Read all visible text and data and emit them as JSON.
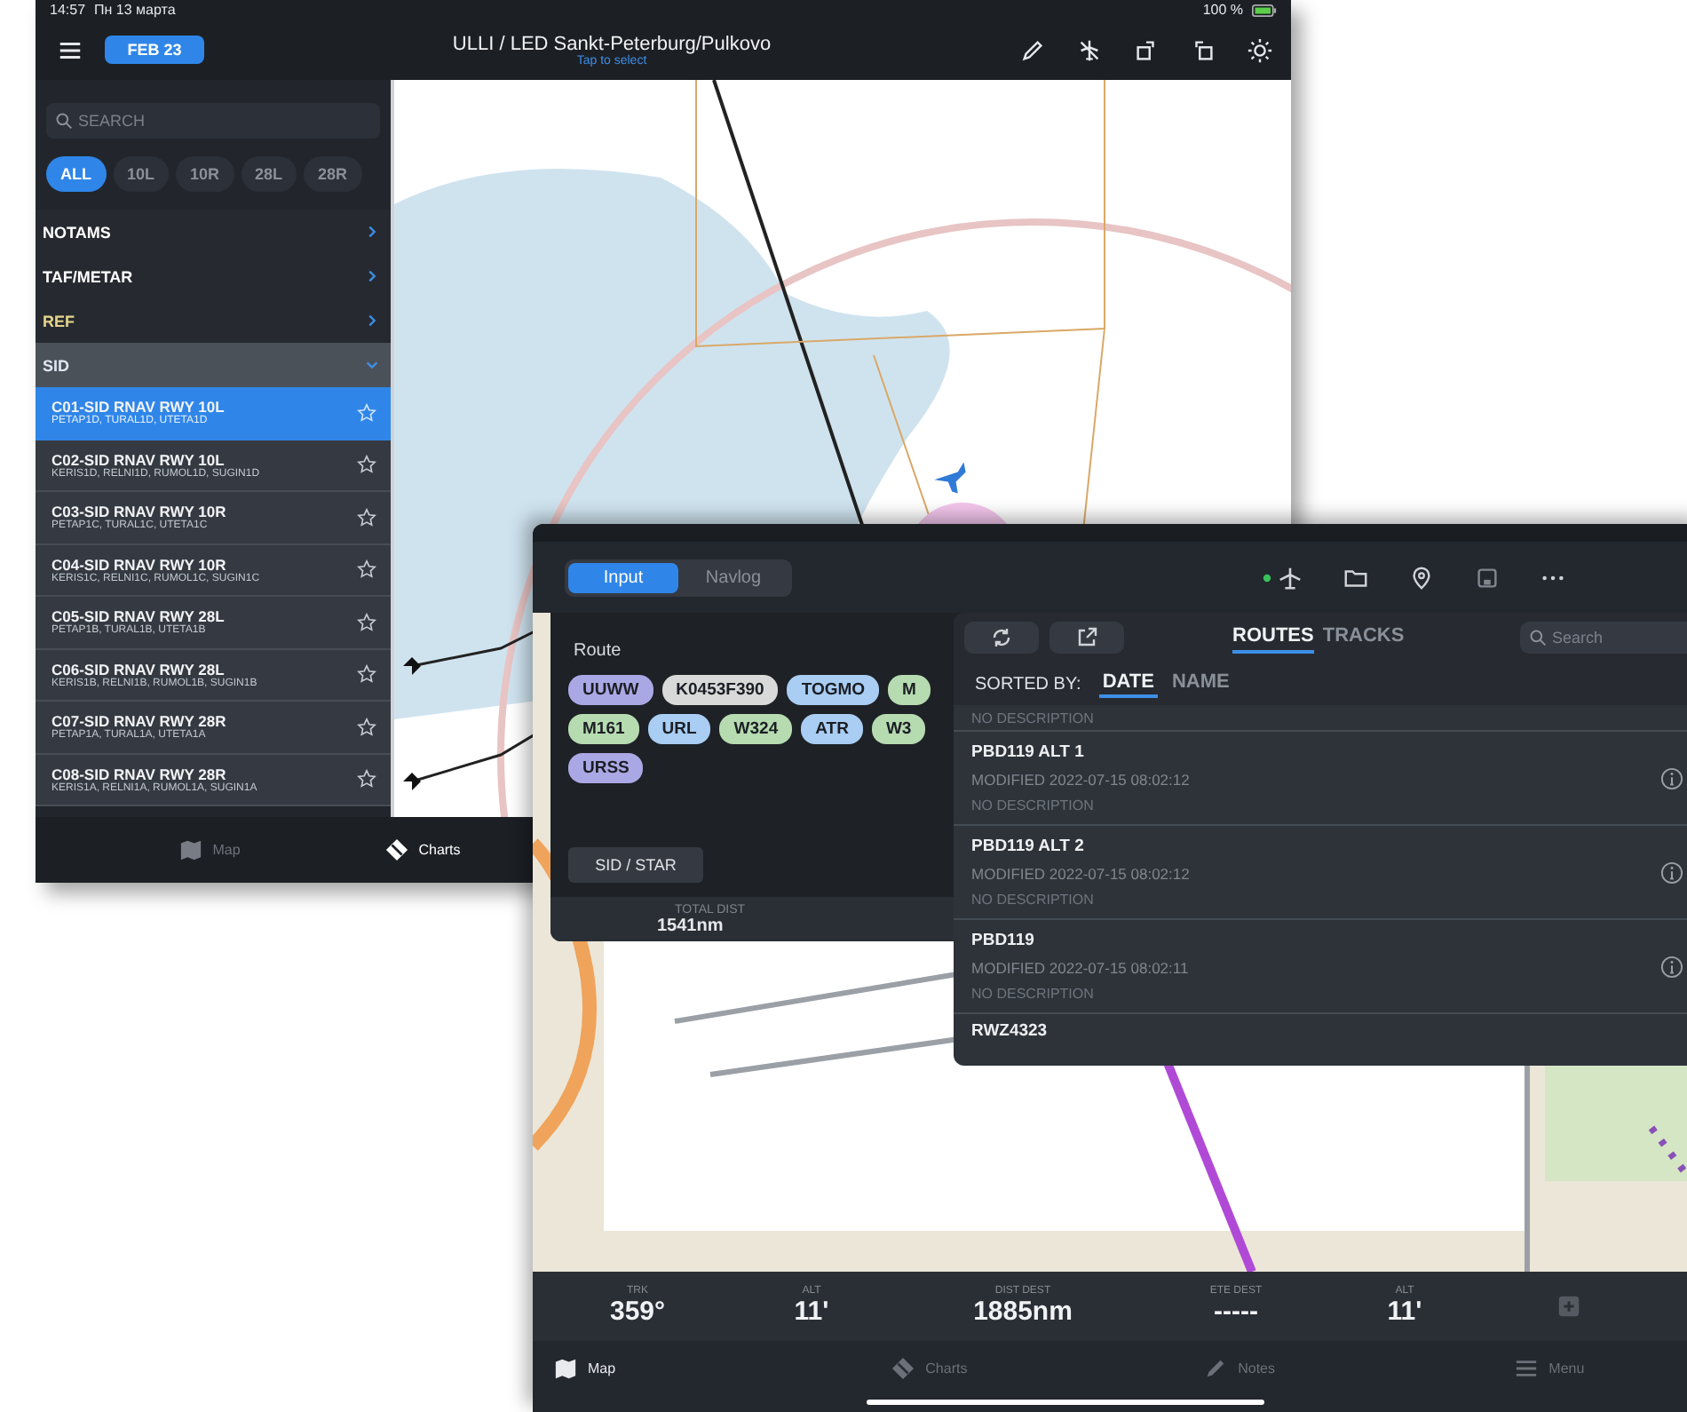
{
  "screen_a": {
    "status_bar": {
      "time": "14:57",
      "date": "Пн 13 марта",
      "battery": "100 %"
    },
    "header": {
      "date_button": "FEB 23",
      "title": "ULLI / LED Sankt-Peterburg/Pulkovo",
      "subtitle": "Tap to select"
    },
    "sidebar": {
      "search": {
        "placeholder": "SEARCH"
      },
      "filters": [
        {
          "label": "ALL",
          "selected": true
        },
        {
          "label": "10L",
          "selected": false
        },
        {
          "label": "10R",
          "selected": false
        },
        {
          "label": "28L",
          "selected": false
        },
        {
          "label": "28R",
          "selected": false
        }
      ],
      "sections": [
        {
          "label": "NOTAMS",
          "expanded": false,
          "color": "#ffffff"
        },
        {
          "label": "TAF/METAR",
          "expanded": false,
          "color": "#ffffff"
        },
        {
          "label": "REF",
          "expanded": false,
          "color": "#e6d48c"
        },
        {
          "label": "SID",
          "expanded": true,
          "color": "#dfe6f0"
        }
      ],
      "items": [
        {
          "title": "C01-SID RNAV RWY 10L",
          "subtitle": "PETAP1D, TURAL1D, UTETA1D",
          "selected": true
        },
        {
          "title": "C02-SID RNAV RWY 10L",
          "subtitle": "KERIS1D, RELNI1D, RUMOL1D, SUGIN1D",
          "selected": false
        },
        {
          "title": "C03-SID RNAV RWY 10R",
          "subtitle": "PETAP1C, TURAL1C, UTETA1C",
          "selected": false
        },
        {
          "title": "C04-SID RNAV RWY 10R",
          "subtitle": "KERIS1C, RELNI1C, RUMOL1C, SUGIN1C",
          "selected": false
        },
        {
          "title": "C05-SID RNAV RWY 28L",
          "subtitle": "PETAP1B, TURAL1B, UTETA1B",
          "selected": false
        },
        {
          "title": "C06-SID RNAV RWY 28L",
          "subtitle": "KERIS1B, RELNI1B, RUMOL1B, SUGIN1B",
          "selected": false
        },
        {
          "title": "C07-SID RNAV RWY 28R",
          "subtitle": "PETAP1A, TURAL1A, UTETA1A",
          "selected": false
        },
        {
          "title": "C08-SID RNAV RWY 28R",
          "subtitle": "KERIS1A, RELNI1A, RUMOL1A, SUGIN1A",
          "selected": false
        }
      ]
    },
    "tabs": [
      {
        "label": "Map",
        "kind": "map",
        "selected": false
      },
      {
        "label": "Charts",
        "kind": "charts",
        "selected": true
      }
    ]
  },
  "screen_b": {
    "mode_tabs": [
      {
        "label": "Input",
        "selected": true
      },
      {
        "label": "Navlog",
        "selected": false
      }
    ],
    "route": {
      "label": "Route",
      "waypoint_rows": [
        [
          {
            "label": "UUWW",
            "color": "#aaa8e4"
          },
          {
            "label": "K0453F390",
            "color": "#d9d9d9"
          },
          {
            "label": "TOGMO",
            "color": "#a9cdf3"
          },
          {
            "label": "M",
            "color": "#b6dbb0"
          }
        ],
        [
          {
            "label": "M161",
            "color": "#b6dbb0"
          },
          {
            "label": "URL",
            "color": "#a9cdf3"
          },
          {
            "label": "W324",
            "color": "#b6dbb0"
          },
          {
            "label": "ATR",
            "color": "#a9cdf3"
          },
          {
            "label": "W3",
            "color": "#b6dbb0"
          }
        ],
        [
          {
            "label": "URSS",
            "color": "#aaa8e4"
          }
        ]
      ],
      "sid_star_button": "SID / STAR",
      "total_dist_label": "TOTAL DIST",
      "total_dist": "1541nm"
    },
    "routes_panel": {
      "tabs": [
        {
          "label": "ROUTES",
          "selected": true
        },
        {
          "label": "TRACKS",
          "selected": false
        }
      ],
      "search": {
        "placeholder": "Search"
      },
      "sort_label": "SORTED BY:",
      "sort_options": [
        {
          "label": "DATE",
          "selected": true
        },
        {
          "label": "NAME",
          "selected": false
        }
      ],
      "top_cut_description": "NO DESCRIPTION",
      "items": [
        {
          "name": "PBD119 ALT 1",
          "modified": "MODIFIED 2022-07-15 08:02:12",
          "description": "NO DESCRIPTION"
        },
        {
          "name": "PBD119 ALT 2",
          "modified": "MODIFIED 2022-07-15 08:02:12",
          "description": "NO DESCRIPTION"
        },
        {
          "name": "PBD119",
          "modified": "MODIFIED 2022-07-15 08:02:11",
          "description": "NO DESCRIPTION"
        }
      ],
      "bottom_cut_name": "RWZ4323"
    },
    "data_bar": [
      {
        "label": "TRK",
        "value": "359°"
      },
      {
        "label": "ALT",
        "value": "11'"
      },
      {
        "label": "DIST DEST",
        "value": "1885nm"
      },
      {
        "label": "ETE DEST",
        "value": "-----"
      },
      {
        "label": "ALT",
        "value": "11'"
      }
    ],
    "tabs": [
      {
        "label": "Map",
        "kind": "map",
        "selected": true
      },
      {
        "label": "Charts",
        "kind": "charts",
        "selected": false
      },
      {
        "label": "Notes",
        "kind": "notes",
        "selected": false
      },
      {
        "label": "Menu",
        "kind": "menu",
        "selected": false
      }
    ]
  }
}
